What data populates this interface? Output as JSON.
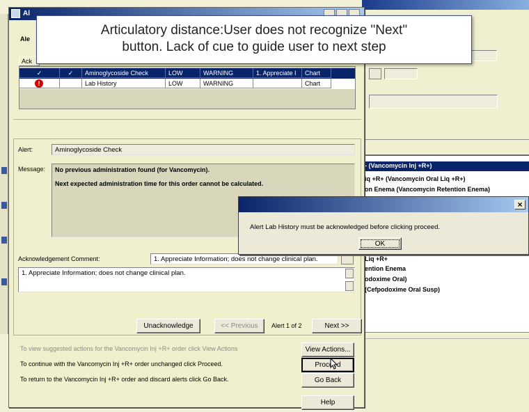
{
  "callout": {
    "line1": "Articulatory distance:User does not recognize \"Next\"",
    "line2": "button. Lack of cue to guide user to next step"
  },
  "alert_window": {
    "title": "Al",
    "tab_label": "Ale",
    "ack_tab": "Ack",
    "grid_rows": [
      {
        "check1": "✓",
        "check2": "✓",
        "name": "Aminoglycoside Check",
        "level": "LOW",
        "type": "WARNING",
        "comment": "1. Appreciate I",
        "chart": "Chart"
      },
      {
        "check1": "!",
        "check2": "",
        "name": "Lab History",
        "level": "LOW",
        "type": "WARNING",
        "comment": "",
        "chart": "Chart"
      }
    ],
    "alert_label": "Alert:",
    "alert_value": "Aminoglycoside Check",
    "message_label": "Message:",
    "message_line1": "No previous administration found (for Vancomycin).",
    "message_line2": "Next expected administration time for this order cannot be calculated.",
    "ack_comment_label": "Acknowledgement Comment:",
    "ack_comment_select": "1. Appreciate Information; does not change clinical plan.",
    "ack_comment_text": "1. Appreciate Information; does not change clinical plan.",
    "unacknowledge_btn": "Unacknowledge",
    "previous_btn": "<< Previous",
    "alert_counter": "Alert 1 of 2",
    "next_btn": "Next >>",
    "footer_line1": "To view suggested actions for the Vancomycin Inj +R+ order click View Actions",
    "footer_line2": "To continue with the Vancomycin Inj +R+ order unchanged click Proceed.",
    "footer_line3": "To return to the Vancomycin Inj +R+ order and discard alerts click Go Back.",
    "view_actions_btn": "View Actions...",
    "proceed_btn": "Proceed",
    "go_back_btn": "Go Back",
    "help_btn": "Help"
  },
  "background_list": {
    "items": [
      "- (Vancomycin Inj +R+)",
      "iq +R+ (Vancomycin Oral Liq +R+)",
      "on Enema (Vancomycin Retention Enema)",
      "Liq +R+",
      "ention Enema",
      "odoxime Oral)",
      "(Cefpodoxime Oral Susp)"
    ]
  },
  "message_box": {
    "close_symbol": "×",
    "text": "Alert Lab History must be acknowledged before clicking proceed.",
    "ok_btn": "OK"
  },
  "colors": {
    "titlebar_active": "#0a246a",
    "titlebar_grad": "#a6caf0",
    "dialog_bg": "#f1f0ce",
    "grid_select": "#0a246a",
    "alert_icon": "#d00000"
  }
}
